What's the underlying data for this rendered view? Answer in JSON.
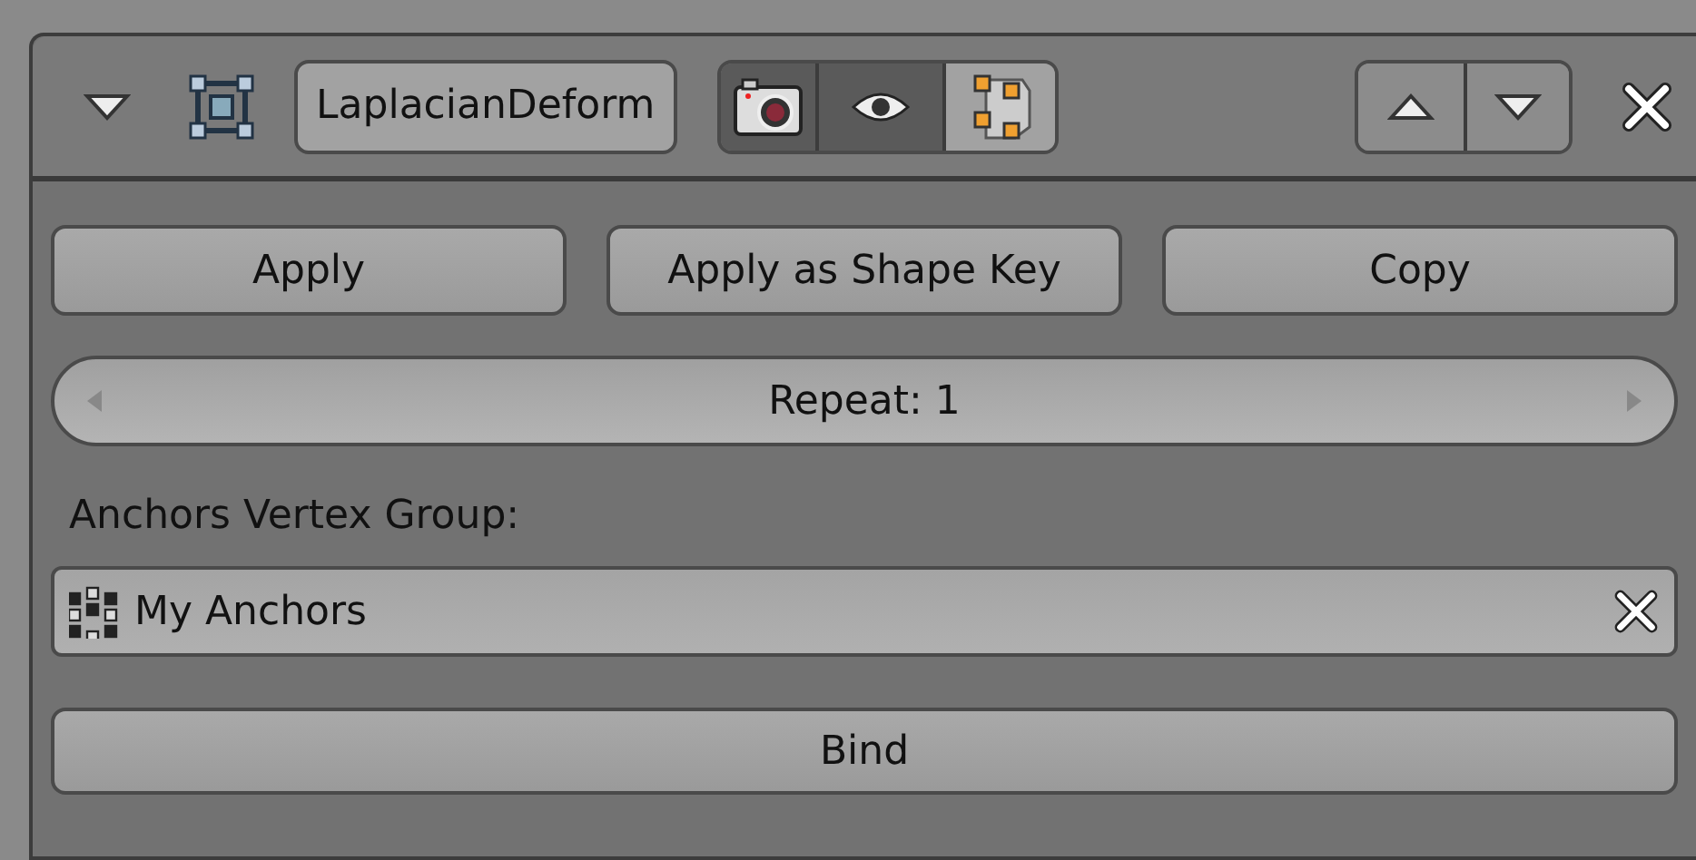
{
  "modifier": {
    "expanded": true,
    "name": "LaplacianDeform",
    "toggles": [
      {
        "kind": "render",
        "on": true
      },
      {
        "kind": "viewport",
        "on": true
      },
      {
        "kind": "editmode",
        "on": false
      }
    ]
  },
  "actions": [
    "Apply",
    "Apply as Shape Key",
    "Copy"
  ],
  "repeat": {
    "label": "Repeat: 1"
  },
  "anchors_label": "Anchors Vertex Group:",
  "anchors_field": {
    "value": "My Anchors"
  },
  "bind_button": "Bind"
}
